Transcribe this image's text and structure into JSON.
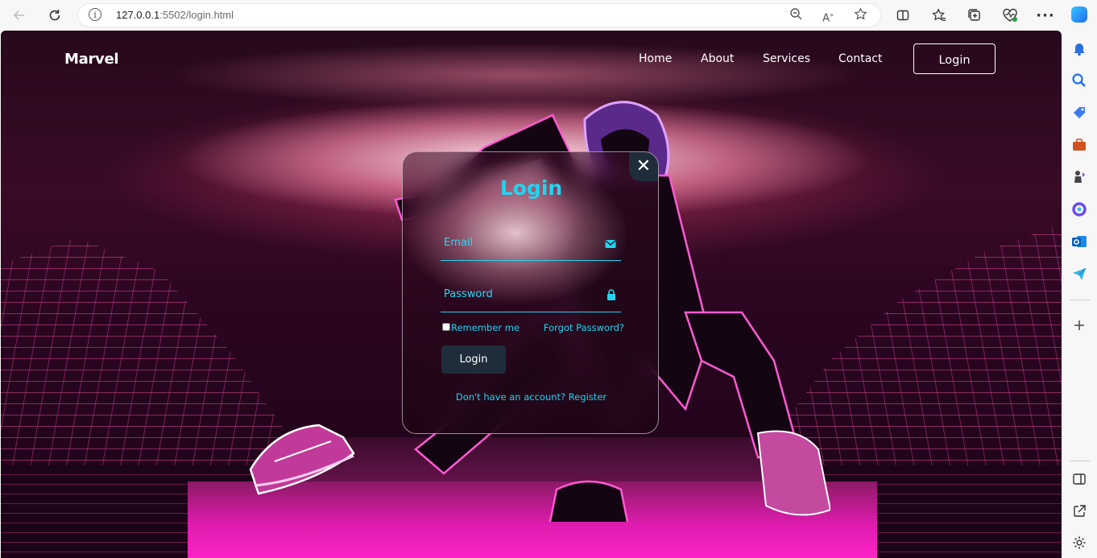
{
  "browser": {
    "url_host": "127.0.0.1",
    "url_rest": ":5502/login.html"
  },
  "nav": {
    "brand": "Marvel",
    "links": [
      "Home",
      "About",
      "Services",
      "Contact"
    ],
    "login_button": "Login"
  },
  "login_card": {
    "title": "Login",
    "email_label": "Email",
    "password_label": "Password",
    "remember_label": "Remember me",
    "forgot_label": "Forgot Password?",
    "submit_label": "Login",
    "register_prompt": "Don't have an account?",
    "register_link": "Register",
    "close_symbol": "✕"
  },
  "colors": {
    "accent": "#22d4f0",
    "button_bg": "#1f2d3a",
    "platform": "#ff24c8"
  }
}
